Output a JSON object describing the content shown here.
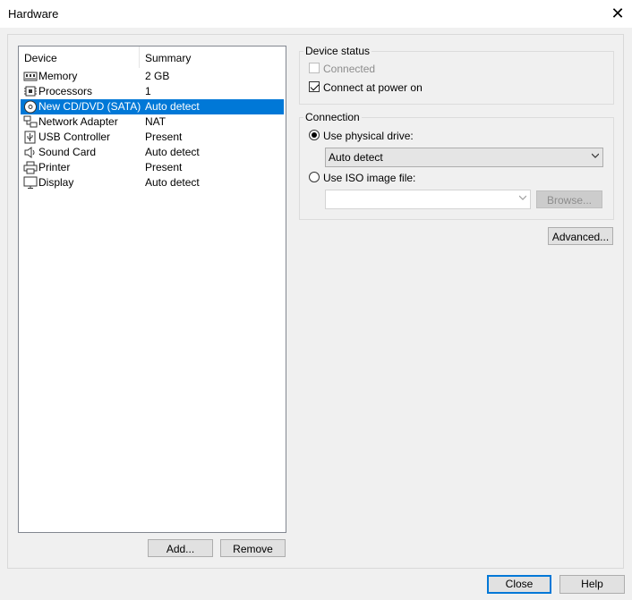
{
  "window": {
    "title": "Hardware",
    "close_glyph": "✕"
  },
  "device_list": {
    "columns": {
      "device": "Device",
      "summary": "Summary"
    },
    "items": [
      {
        "name": "Memory",
        "summary": "2 GB",
        "icon": "memory-icon"
      },
      {
        "name": "Processors",
        "summary": "1",
        "icon": "processor-icon"
      },
      {
        "name": "New CD/DVD (SATA)",
        "summary": "Auto detect",
        "icon": "cd-dvd-icon",
        "selected": true
      },
      {
        "name": "Network Adapter",
        "summary": "NAT",
        "icon": "network-adapter-icon"
      },
      {
        "name": "USB Controller",
        "summary": "Present",
        "icon": "usb-icon"
      },
      {
        "name": "Sound Card",
        "summary": "Auto detect",
        "icon": "speaker-icon"
      },
      {
        "name": "Printer",
        "summary": "Present",
        "icon": "printer-icon"
      },
      {
        "name": "Display",
        "summary": "Auto detect",
        "icon": "monitor-icon"
      }
    ],
    "add_label": "Add...",
    "remove_label": "Remove"
  },
  "device_status": {
    "title": "Device status",
    "connected_label": "Connected",
    "connected_checked": false,
    "connected_enabled": false,
    "connect_power_label": "Connect at power on",
    "connect_power_checked": true
  },
  "connection": {
    "title": "Connection",
    "physical_label": "Use physical drive:",
    "physical_selected": true,
    "physical_value": "Auto detect",
    "iso_label": "Use ISO image file:",
    "iso_selected": false,
    "iso_value": "",
    "browse_label": "Browse..."
  },
  "advanced_label": "Advanced...",
  "footer": {
    "close_label": "Close",
    "help_label": "Help"
  },
  "colors": {
    "selection": "#0078d7",
    "window_bg": "#f0f0f0"
  }
}
